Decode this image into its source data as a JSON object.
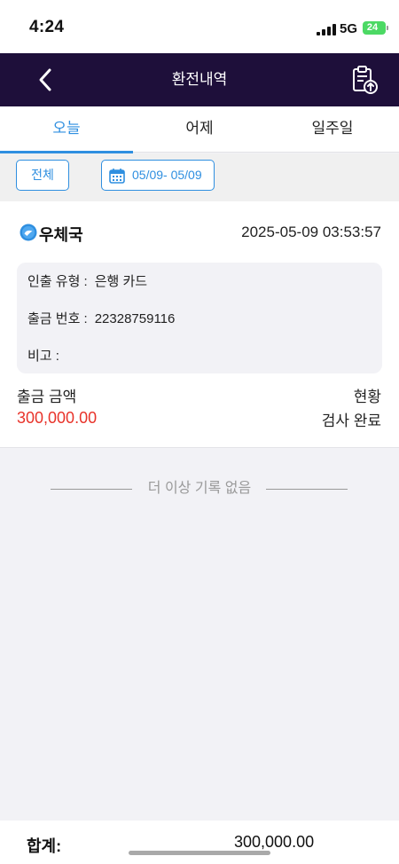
{
  "status_bar": {
    "time": "4:24",
    "network": "5G",
    "battery": "24"
  },
  "header": {
    "title": "환전내역"
  },
  "tabs": [
    {
      "label": "오늘",
      "active": true
    },
    {
      "label": "어제",
      "active": false
    },
    {
      "label": "일주일",
      "active": false
    }
  ],
  "filters": {
    "all_label": "전체",
    "date_range": "05/09- 05/09"
  },
  "record": {
    "bank_name": "우체국",
    "timestamp": "2025-05-09 03:53:57",
    "withdraw_type_label": "인출 유형 :",
    "withdraw_type_value": "은행 카드",
    "withdraw_no_label": "출금 번호 :",
    "withdraw_no_value": "22328759116",
    "remark_label": "비고 :",
    "remark_value": "",
    "amount_label": "출금 금액",
    "amount_value": "300,000.00",
    "status_label": "현황",
    "status_value": "검사 완료"
  },
  "list_end_text": "더 이상 기록 없음",
  "footer": {
    "total_label": "합계:",
    "total_value": "300,000.00"
  },
  "colors": {
    "nav_bg": "#1e0f3a",
    "accent": "#2f8fe0",
    "amount": "#e8332a",
    "battery": "#4cd964"
  },
  "icons": {
    "back": "chevron-left-icon",
    "export": "clipboard-upload-icon",
    "calendar": "calendar-icon",
    "bank": "post-office-icon"
  }
}
